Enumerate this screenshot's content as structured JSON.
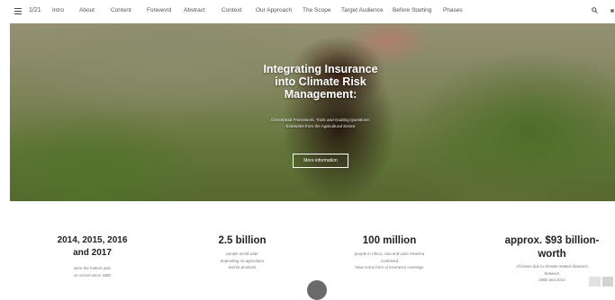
{
  "nav": {
    "page_counter": "1/21",
    "items": [
      "Intro",
      "About",
      "Content",
      "Foreword",
      "Abstract",
      "Context",
      "Our Approach",
      "The Scope",
      "Target Audience",
      "Before Starting",
      "Phases"
    ],
    "icons": [
      "menu-icon",
      "search-icon"
    ]
  },
  "hero": {
    "title": "Integrating Insurance into Climate Risk Management:",
    "subtitle_line1": "Conceptual Framework, Tools and Guiding Questions:",
    "subtitle_line2": "Examples from the Agricultural Sector",
    "button_label": "More information"
  },
  "stats": [
    {
      "value": "2014, 2015, 2016 and 2017",
      "desc": [
        "were the hottest year",
        "on record since 1880"
      ]
    },
    {
      "value": "2.5 billion",
      "desc": [
        "people world wide",
        "depending on agriculture",
        "and its products"
      ]
    },
    {
      "value": "100 million",
      "desc": [
        "people in Africa, Asia and Latin America",
        "combined",
        "have some form of insurance coverage"
      ]
    },
    {
      "value": "approx. $93 billion-worth",
      "desc": [
        "of losses due to climate-related disasters",
        "between",
        "1980 and 2014"
      ]
    }
  ]
}
